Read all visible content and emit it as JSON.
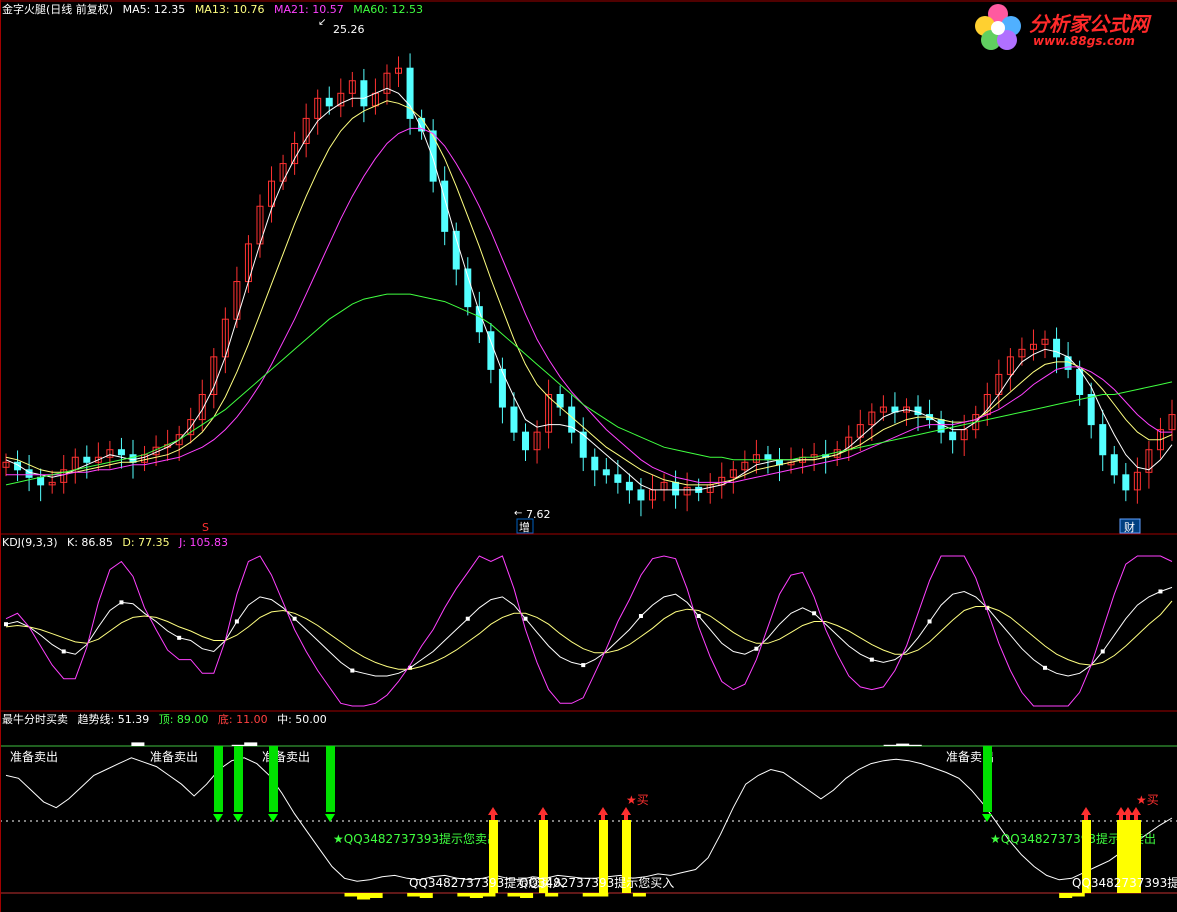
{
  "panel1": {
    "legend": [
      {
        "text": "金字火腿(日线 前复权)",
        "color": "#ffffff"
      },
      {
        "text": "MA5: 12.35",
        "color": "#ffffff"
      },
      {
        "text": "MA13: 10.76",
        "color": "#ffff80"
      },
      {
        "text": "MA21: 10.57",
        "color": "#ff40ff"
      },
      {
        "text": "MA60: 12.53",
        "color": "#40ff40"
      }
    ],
    "high_label": "25.26",
    "low_label": "7.62",
    "marker_s": "S",
    "marker_zeng": "增",
    "marker_caibao": "财"
  },
  "panel2": {
    "legend": [
      {
        "text": "KDJ(9,3,3)",
        "color": "#ffffff"
      },
      {
        "text": "K: 86.85",
        "color": "#ffffff"
      },
      {
        "text": "D: 77.35",
        "color": "#ffff80"
      },
      {
        "text": "J: 105.83",
        "color": "#ff40ff"
      }
    ]
  },
  "panel3": {
    "legend": [
      {
        "text": "最牛分时买卖",
        "color": "#ffffff"
      },
      {
        "text": "趋势线: 51.39",
        "color": "#ffffff"
      },
      {
        "text": "顶: 89.00",
        "color": "#40ff40"
      },
      {
        "text": "底: 11.00",
        "color": "#ff4040"
      },
      {
        "text": "中: 50.00",
        "color": "#ffffff"
      }
    ],
    "sell_ready": "准备卖出",
    "sell_hint": "★QQ3482737393提示您卖出",
    "buy_hint": "QQ3482737393提示您买入",
    "buy_mark": "★买"
  },
  "logo": {
    "title": "分析家公式网",
    "url": "www.88gs.com"
  },
  "colors": {
    "up": "#ff3232",
    "down": "#54ffff",
    "ma5": "#ffffff",
    "ma13": "#ffff80",
    "ma21": "#ff40ff",
    "ma60": "#40ff40",
    "panel_border": "#a00000"
  },
  "chart_data": [
    {
      "type": "candlestick",
      "title": "金字火腿(日线 前复权)",
      "ylim": [
        7,
        27
      ],
      "annotations": [
        "25.26",
        "7.62"
      ],
      "series": [
        {
          "name": "close",
          "values": [
            9.3,
            9.0,
            8.7,
            8.4,
            8.5,
            9.0,
            9.5,
            9.3,
            9.5,
            9.8,
            9.6,
            9.3,
            9.6,
            9.9,
            10.0,
            10.4,
            11.0,
            12.0,
            13.5,
            15.0,
            16.5,
            18.0,
            19.5,
            20.5,
            21.2,
            22.0,
            23.0,
            23.8,
            23.5,
            24.0,
            24.5,
            23.5,
            24.0,
            24.8,
            25.0,
            23.0,
            22.5,
            20.5,
            18.5,
            17.0,
            15.5,
            14.5,
            13.0,
            11.5,
            10.5,
            9.8,
            10.5,
            12.0,
            11.5,
            10.5,
            9.5,
            9.0,
            8.8,
            8.5,
            8.2,
            7.8,
            8.2,
            8.5,
            8.0,
            8.3,
            8.1,
            8.4,
            8.7,
            9.0,
            9.3,
            9.6,
            9.4,
            9.2,
            9.3,
            9.5,
            9.6,
            9.5,
            9.8,
            10.3,
            10.8,
            11.3,
            11.5,
            11.3,
            11.5,
            11.2,
            11.0,
            10.5,
            10.2,
            10.6,
            11.2,
            12.0,
            12.8,
            13.5,
            13.8,
            14.0,
            14.2,
            13.5,
            13.0,
            12.0,
            10.8,
            9.6,
            8.8,
            8.2,
            8.9,
            9.8,
            10.6,
            11.2
          ]
        },
        {
          "name": "MA5",
          "values": [
            9.4,
            9.2,
            8.9,
            8.8,
            8.7,
            8.8,
            9.0,
            9.2,
            9.4,
            9.6,
            9.5,
            9.4,
            9.5,
            9.7,
            9.9,
            10.2,
            10.7,
            11.4,
            12.3,
            13.5,
            15.0,
            16.5,
            18.0,
            19.4,
            20.5,
            21.4,
            22.2,
            22.9,
            23.3,
            23.6,
            23.8,
            23.8,
            24.0,
            24.2,
            24.0,
            23.5,
            22.6,
            21.4,
            19.8,
            18.2,
            16.7,
            15.3,
            14.1,
            12.9,
            11.9,
            11.0,
            10.7,
            10.8,
            10.8,
            10.7,
            10.4,
            10.0,
            9.6,
            9.2,
            8.8,
            8.4,
            8.2,
            8.2,
            8.2,
            8.2,
            8.2,
            8.3,
            8.4,
            8.6,
            8.9,
            9.2,
            9.3,
            9.4,
            9.4,
            9.4,
            9.4,
            9.5,
            9.6,
            9.9,
            10.3,
            10.7,
            11.1,
            11.3,
            11.4,
            11.3,
            11.1,
            10.8,
            10.6,
            10.6,
            10.9,
            11.4,
            12.0,
            12.7,
            13.3,
            13.6,
            13.8,
            13.7,
            13.5,
            13.0,
            12.3,
            11.3,
            10.4,
            9.6,
            9.1,
            9.0,
            9.4,
            10.0
          ]
        },
        {
          "name": "MA13",
          "values": [
            9.5,
            9.4,
            9.2,
            9.0,
            8.9,
            8.9,
            8.9,
            9.0,
            9.1,
            9.2,
            9.3,
            9.3,
            9.4,
            9.5,
            9.6,
            9.8,
            10.1,
            10.5,
            11.1,
            11.9,
            12.9,
            14.0,
            15.2,
            16.4,
            17.6,
            18.8,
            19.9,
            20.9,
            21.8,
            22.5,
            23.0,
            23.3,
            23.5,
            23.7,
            23.6,
            23.4,
            23.0,
            22.3,
            21.4,
            20.3,
            19.1,
            17.9,
            16.6,
            15.4,
            14.2,
            13.2,
            12.4,
            11.9,
            11.5,
            11.1,
            10.7,
            10.3,
            9.9,
            9.6,
            9.3,
            9.0,
            8.8,
            8.6,
            8.5,
            8.4,
            8.4,
            8.4,
            8.5,
            8.6,
            8.8,
            9.0,
            9.1,
            9.2,
            9.3,
            9.4,
            9.4,
            9.5,
            9.6,
            9.8,
            10.0,
            10.3,
            10.6,
            10.8,
            11.0,
            11.1,
            11.1,
            11.0,
            10.9,
            10.9,
            11.0,
            11.3,
            11.7,
            12.1,
            12.5,
            12.9,
            13.2,
            13.3,
            13.3,
            13.1,
            12.7,
            12.2,
            11.6,
            11.0,
            10.5,
            10.2,
            10.2,
            10.4
          ]
        },
        {
          "name": "MA21",
          "values": [
            8.8,
            8.8,
            8.8,
            8.8,
            8.8,
            8.8,
            8.9,
            8.9,
            9.0,
            9.0,
            9.1,
            9.2,
            9.2,
            9.3,
            9.4,
            9.5,
            9.7,
            9.9,
            10.2,
            10.6,
            11.1,
            11.7,
            12.4,
            13.2,
            14.1,
            15.0,
            16.0,
            17.0,
            18.0,
            19.0,
            19.9,
            20.7,
            21.4,
            22.0,
            22.4,
            22.6,
            22.6,
            22.4,
            21.9,
            21.2,
            20.4,
            19.5,
            18.5,
            17.4,
            16.3,
            15.2,
            14.2,
            13.4,
            12.7,
            12.1,
            11.6,
            11.1,
            10.6,
            10.2,
            9.8,
            9.4,
            9.1,
            8.9,
            8.7,
            8.6,
            8.5,
            8.5,
            8.5,
            8.5,
            8.6,
            8.7,
            8.8,
            8.9,
            9.0,
            9.1,
            9.2,
            9.3,
            9.4,
            9.5,
            9.7,
            9.9,
            10.1,
            10.3,
            10.5,
            10.7,
            10.8,
            10.8,
            10.8,
            10.9,
            11.0,
            11.2,
            11.4,
            11.7,
            12.0,
            12.4,
            12.7,
            13.0,
            13.1,
            13.1,
            12.9,
            12.6,
            12.2,
            11.7,
            11.2,
            10.8,
            10.5,
            10.5
          ]
        },
        {
          "name": "MA60",
          "values": [
            8.4,
            8.5,
            8.6,
            8.7,
            8.8,
            8.9,
            9.0,
            9.1,
            9.2,
            9.3,
            9.4,
            9.5,
            9.6,
            9.8,
            10.0,
            10.2,
            10.5,
            10.8,
            11.1,
            11.4,
            11.8,
            12.2,
            12.6,
            13.0,
            13.4,
            13.8,
            14.2,
            14.6,
            15.0,
            15.3,
            15.6,
            15.8,
            15.9,
            16.0,
            16.0,
            16.0,
            15.9,
            15.8,
            15.7,
            15.5,
            15.3,
            15.1,
            14.8,
            14.4,
            14.0,
            13.6,
            13.2,
            12.8,
            12.4,
            12.0,
            11.6,
            11.3,
            11.0,
            10.7,
            10.5,
            10.3,
            10.1,
            9.9,
            9.8,
            9.7,
            9.6,
            9.5,
            9.5,
            9.4,
            9.4,
            9.4,
            9.4,
            9.4,
            9.4,
            9.5,
            9.5,
            9.6,
            9.7,
            9.8,
            9.9,
            10.0,
            10.1,
            10.2,
            10.3,
            10.4,
            10.5,
            10.6,
            10.7,
            10.8,
            10.9,
            11.0,
            11.1,
            11.2,
            11.3,
            11.4,
            11.5,
            11.6,
            11.7,
            11.8,
            11.9,
            12.0,
            12.0,
            12.1,
            12.2,
            12.3,
            12.4,
            12.5
          ]
        }
      ]
    },
    {
      "type": "line",
      "title": "KDJ(9,3,3)",
      "ylim": [
        0,
        110
      ],
      "series": [
        {
          "name": "K",
          "values": [
            60,
            62,
            58,
            52,
            45,
            40,
            38,
            45,
            58,
            70,
            76,
            75,
            68,
            62,
            55,
            50,
            48,
            42,
            40,
            48,
            62,
            74,
            80,
            78,
            72,
            64,
            56,
            48,
            40,
            32,
            26,
            24,
            22,
            22,
            24,
            28,
            34,
            40,
            48,
            56,
            64,
            72,
            78,
            80,
            74,
            64,
            54,
            44,
            36,
            32,
            30,
            34,
            40,
            48,
            56,
            66,
            74,
            80,
            82,
            76,
            66,
            56,
            46,
            40,
            38,
            42,
            50,
            60,
            68,
            72,
            68,
            60,
            52,
            44,
            38,
            34,
            32,
            34,
            40,
            50,
            62,
            74,
            82,
            84,
            80,
            72,
            62,
            52,
            42,
            34,
            28,
            24,
            22,
            24,
            30,
            40,
            52,
            64,
            74,
            80,
            84,
            87
          ]
        },
        {
          "name": "D",
          "values": [
            58,
            59,
            58,
            56,
            53,
            50,
            47,
            46,
            49,
            55,
            61,
            65,
            66,
            65,
            62,
            58,
            55,
            51,
            48,
            48,
            52,
            58,
            65,
            69,
            70,
            68,
            64,
            59,
            53,
            47,
            41,
            36,
            32,
            29,
            27,
            27,
            29,
            32,
            36,
            41,
            47,
            53,
            60,
            65,
            68,
            68,
            65,
            60,
            53,
            47,
            42,
            39,
            39,
            41,
            45,
            51,
            57,
            64,
            69,
            71,
            70,
            66,
            60,
            54,
            49,
            46,
            46,
            49,
            54,
            59,
            62,
            62,
            59,
            55,
            50,
            45,
            41,
            38,
            38,
            41,
            47,
            55,
            63,
            70,
            73,
            73,
            70,
            65,
            58,
            51,
            44,
            38,
            34,
            31,
            30,
            32,
            37,
            44,
            52,
            60,
            67,
            77
          ]
        },
        {
          "name": "J",
          "values": [
            64,
            68,
            58,
            44,
            30,
            20,
            20,
            43,
            76,
            100,
            106,
            95,
            72,
            56,
            41,
            34,
            34,
            24,
            24,
            48,
            82,
            106,
            110,
            96,
            76,
            56,
            40,
            26,
            14,
            2,
            0,
            0,
            2,
            8,
            18,
            30,
            44,
            56,
            72,
            86,
            98,
            110,
            106,
            110,
            86,
            56,
            32,
            12,
            2,
            2,
            6,
            24,
            42,
            62,
            78,
            96,
            108,
            110,
            108,
            86,
            58,
            36,
            18,
            12,
            16,
            34,
            58,
            82,
            96,
            98,
            80,
            56,
            38,
            22,
            14,
            12,
            14,
            26,
            44,
            68,
            92,
            110,
            110,
            110,
            94,
            70,
            46,
            26,
            10,
            0,
            0,
            0,
            0,
            10,
            30,
            56,
            82,
            104,
            110,
            110,
            110,
            106
          ]
        }
      ]
    },
    {
      "type": "line",
      "title": "最牛分时买卖",
      "ylim": [
        0,
        100
      ],
      "series": [
        {
          "name": "趋势线",
          "values": [
            80,
            78,
            70,
            62,
            58,
            64,
            72,
            80,
            84,
            88,
            92,
            89,
            86,
            80,
            74,
            66,
            74,
            84,
            90,
            92,
            88,
            80,
            68,
            54,
            42,
            30,
            18,
            10,
            8,
            9,
            11,
            12,
            10,
            9,
            11,
            12,
            10,
            9,
            10,
            12,
            10,
            9,
            11,
            10,
            12,
            11,
            10,
            10,
            11,
            12,
            10,
            11,
            13,
            12,
            14,
            16,
            24,
            40,
            58,
            74,
            80,
            84,
            82,
            76,
            70,
            64,
            70,
            78,
            84,
            88,
            90,
            91,
            90,
            88,
            85,
            82,
            78,
            70,
            60,
            48,
            36,
            26,
            18,
            12,
            9,
            10,
            14,
            18,
            22,
            28,
            34,
            40,
            46,
            51
          ]
        }
      ]
    }
  ]
}
